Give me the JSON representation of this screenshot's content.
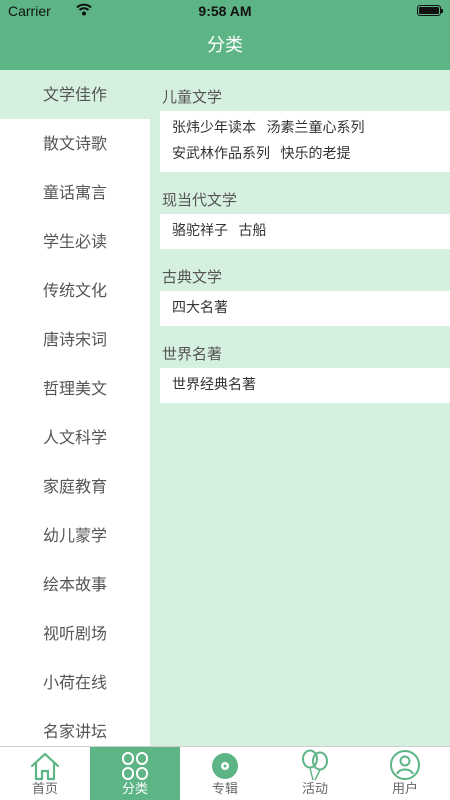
{
  "status": {
    "carrier": "Carrier",
    "time": "9:58 AM"
  },
  "header": {
    "title": "分类"
  },
  "sidebar": {
    "items": [
      {
        "label": "文学佳作"
      },
      {
        "label": "散文诗歌"
      },
      {
        "label": "童话寓言"
      },
      {
        "label": "学生必读"
      },
      {
        "label": "传统文化"
      },
      {
        "label": "唐诗宋词"
      },
      {
        "label": "哲理美文"
      },
      {
        "label": "人文科学"
      },
      {
        "label": "家庭教育"
      },
      {
        "label": "幼儿蒙学"
      },
      {
        "label": "绘本故事"
      },
      {
        "label": "视听剧场"
      },
      {
        "label": "小荷在线"
      },
      {
        "label": "名家讲坛"
      }
    ]
  },
  "sections": [
    {
      "title": "儿童文学",
      "lines": [
        [
          "张炜少年读本",
          "汤素兰童心系列"
        ],
        [
          "安武林作品系列",
          "快乐的老提"
        ]
      ]
    },
    {
      "title": "现当代文学",
      "lines": [
        [
          "骆驼祥子",
          "古船"
        ]
      ]
    },
    {
      "title": "古典文学",
      "lines": [
        [
          "四大名著"
        ]
      ]
    },
    {
      "title": "世界名著",
      "lines": [
        [
          "世界经典名著"
        ]
      ]
    }
  ],
  "tabbar": {
    "items": [
      {
        "label": "首页",
        "icon": "home-icon"
      },
      {
        "label": "分类",
        "icon": "category-icon"
      },
      {
        "label": "专辑",
        "icon": "album-icon"
      },
      {
        "label": "活动",
        "icon": "balloons-icon"
      },
      {
        "label": "用户",
        "icon": "user-icon"
      }
    ]
  },
  "colors": {
    "brand": "#5db585",
    "panel_bg": "#d6f0e0"
  }
}
